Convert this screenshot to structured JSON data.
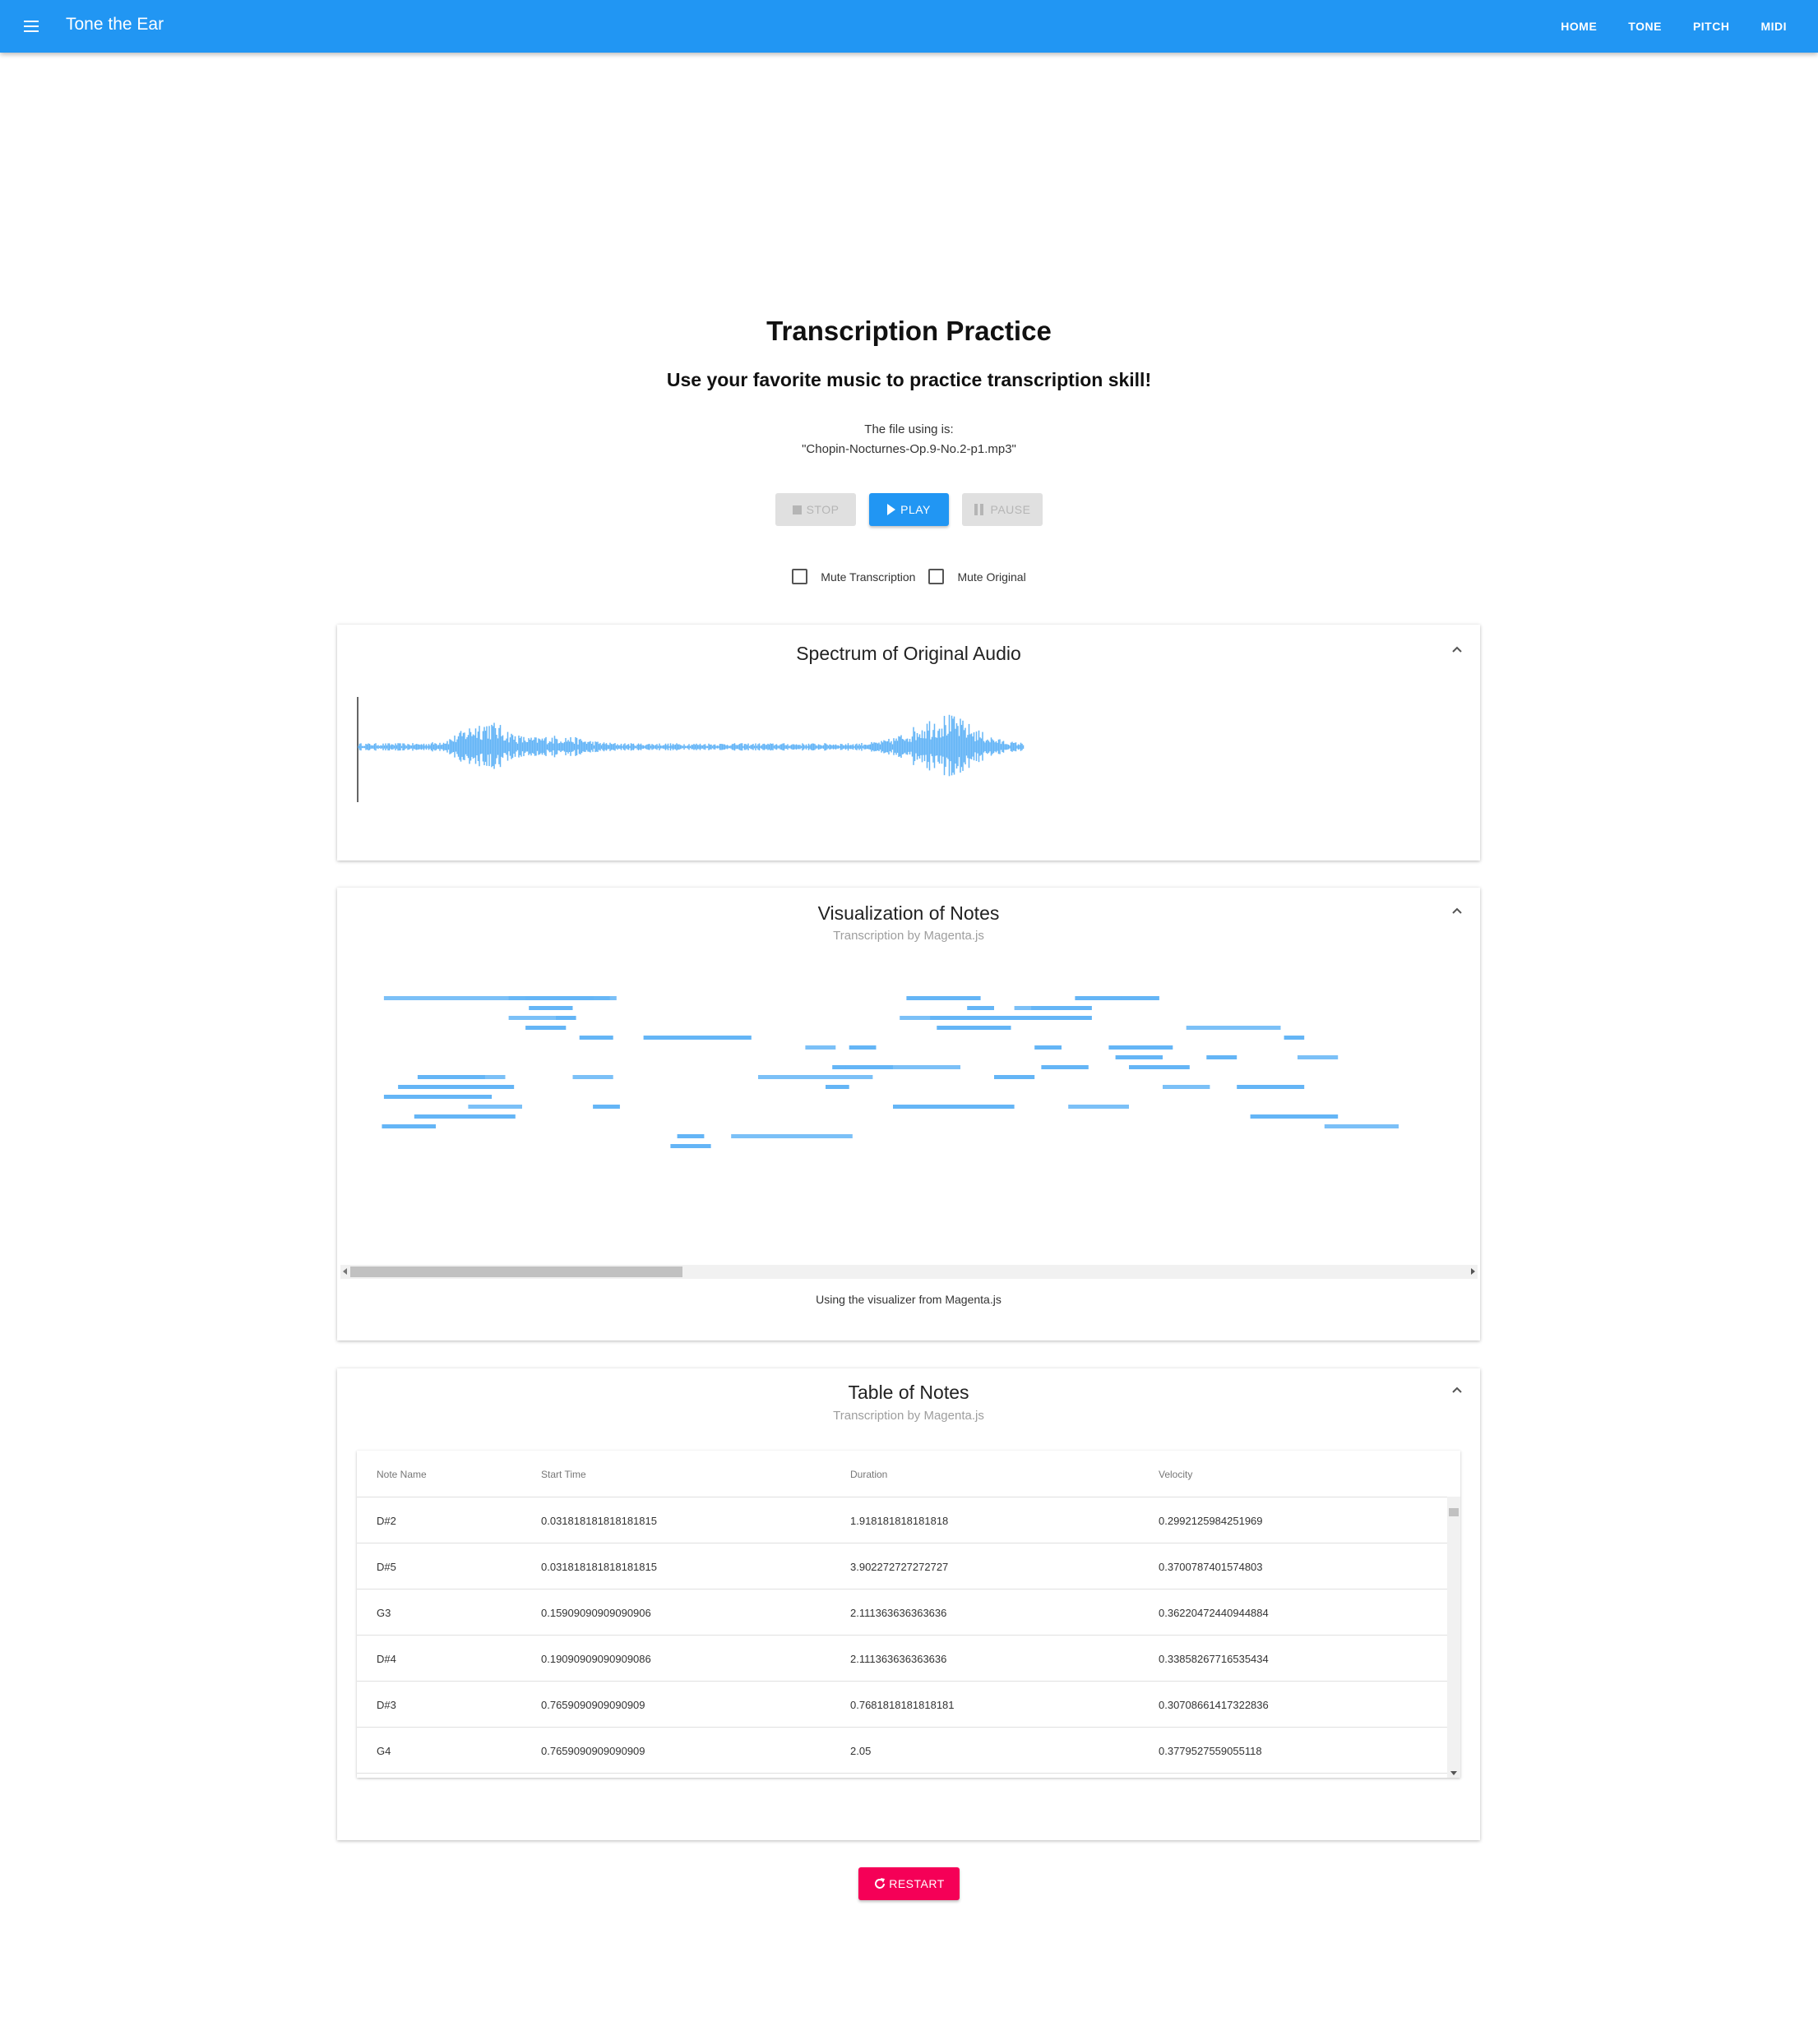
{
  "appbar": {
    "title": "Tone the Ear",
    "nav": [
      "HOME",
      "TONE",
      "PITCH",
      "MIDI"
    ]
  },
  "header": {
    "title": "Transcription Practice",
    "subtitle": "Use your favorite music to practice transcription skill!",
    "file_label": "The file using is:",
    "file_name": "\"Chopin-Nocturnes-Op.9-No.2-p1.mp3\""
  },
  "controls": {
    "stop": "STOP",
    "play": "PLAY",
    "pause": "PAUSE",
    "stop_enabled": false,
    "pause_enabled": false,
    "mute_transcription": {
      "label": "Mute Transcription",
      "checked": false
    },
    "mute_original": {
      "label": "Mute Original",
      "checked": false
    }
  },
  "spectrum": {
    "title": "Spectrum of Original Audio",
    "color": "#64b5f6",
    "cursor_color": "#333333"
  },
  "notes_viz": {
    "title": "Visualization of Notes",
    "subtitle": "Transcription by Magenta.js",
    "caption": "Using the visualizer from Magenta.js",
    "color": "#64b5f6"
  },
  "notes_table": {
    "title": "Table of Notes",
    "subtitle": "Transcription by Magenta.js",
    "columns": [
      "Note Name",
      "Start Time",
      "Duration",
      "Velocity"
    ],
    "rows": [
      [
        "D#2",
        "0.031818181818181815",
        "1.918181818181818",
        "0.2992125984251969"
      ],
      [
        "D#5",
        "0.031818181818181815",
        "3.902272727272727",
        "0.3700787401574803"
      ],
      [
        "G3",
        "0.15909090909090906",
        "2.111363636363636",
        "0.36220472440944884"
      ],
      [
        "D#4",
        "0.19090909090909086",
        "2.111363636363636",
        "0.33858267716535434"
      ],
      [
        "D#3",
        "0.7659090909090909",
        "0.7681818181818181",
        "0.30708661417322836"
      ],
      [
        "G4",
        "0.7659090909090909",
        "2.05",
        "0.3779527559055118"
      ]
    ]
  },
  "restart": {
    "label": "RESTART",
    "color": "#f50057"
  },
  "accent": "#2196f3"
}
